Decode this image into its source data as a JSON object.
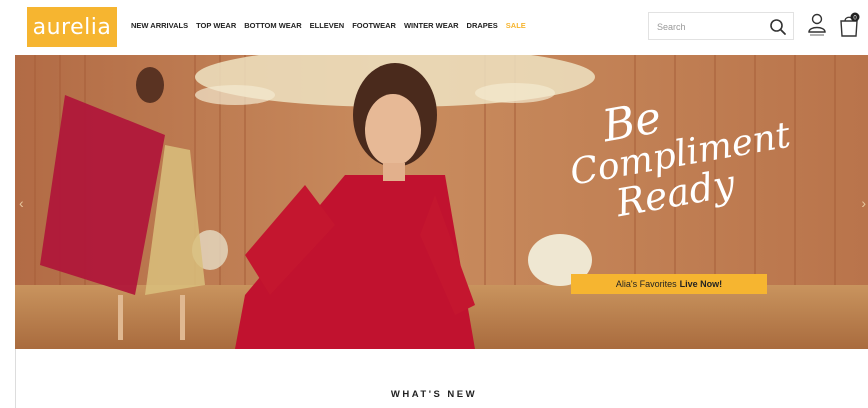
{
  "brand": {
    "logo_text": "aurelia",
    "accent": "#f6b530"
  },
  "nav": {
    "items": [
      {
        "label": "NEW ARRIVALS"
      },
      {
        "label": "TOP WEAR"
      },
      {
        "label": "BOTTOM WEAR"
      },
      {
        "label": "ELLEVEN"
      },
      {
        "label": "FOOTWEAR"
      },
      {
        "label": "WINTER WEAR"
      },
      {
        "label": "DRAPES"
      },
      {
        "label": "SALE",
        "color": "#f6b530"
      }
    ]
  },
  "search": {
    "placeholder": "Search",
    "icon": "search-icon"
  },
  "header_icons": {
    "account": "user-icon",
    "cart": "shopping-bag-icon",
    "cart_count": "0"
  },
  "hero": {
    "headline": [
      "Be",
      "Compliment",
      "Ready"
    ],
    "cta_prefix": "Alia's Favorites",
    "cta_bold": "Live Now!",
    "prev_icon": "chevron-left-icon",
    "next_icon": "chevron-right-icon"
  },
  "section": {
    "title": "WHAT'S NEW"
  }
}
